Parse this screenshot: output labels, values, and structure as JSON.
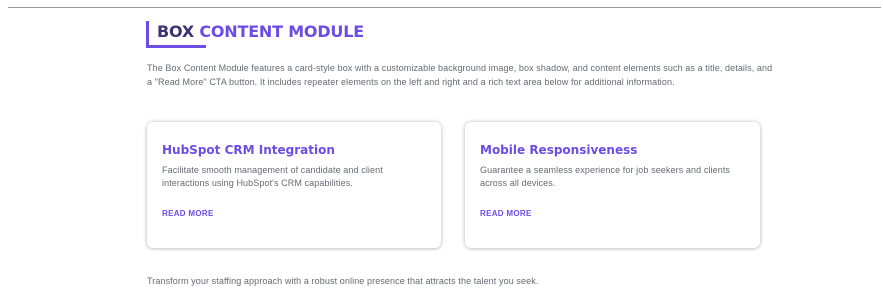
{
  "module": {
    "heading_part1": "BOX ",
    "heading_part2": "CONTENT MODULE",
    "description": "The Box Content Module features a card-style box with a customizable background image, box shadow, and content elements such as a title, details, and a \"Read More\" CTA button. It includes repeater elements on the left and right and a rich text area below for additional information."
  },
  "cards": [
    {
      "title": "HubSpot CRM Integration",
      "text": "Facilitate smooth management of candidate and client interactions using HubSpot's CRM capabilities.",
      "link_label": "READ MORE"
    },
    {
      "title": "Mobile Responsiveness",
      "text": "Guarantee a seamless experience for job seekers and clients across all devices.",
      "link_label": "READ MORE"
    }
  ],
  "footer": {
    "text": "Transform your staffing approach with a robust online presence that attracts the talent you seek."
  },
  "colors": {
    "accent": "#6b4de6",
    "heading_dark": "#3a3470",
    "body_text": "#666a73"
  }
}
